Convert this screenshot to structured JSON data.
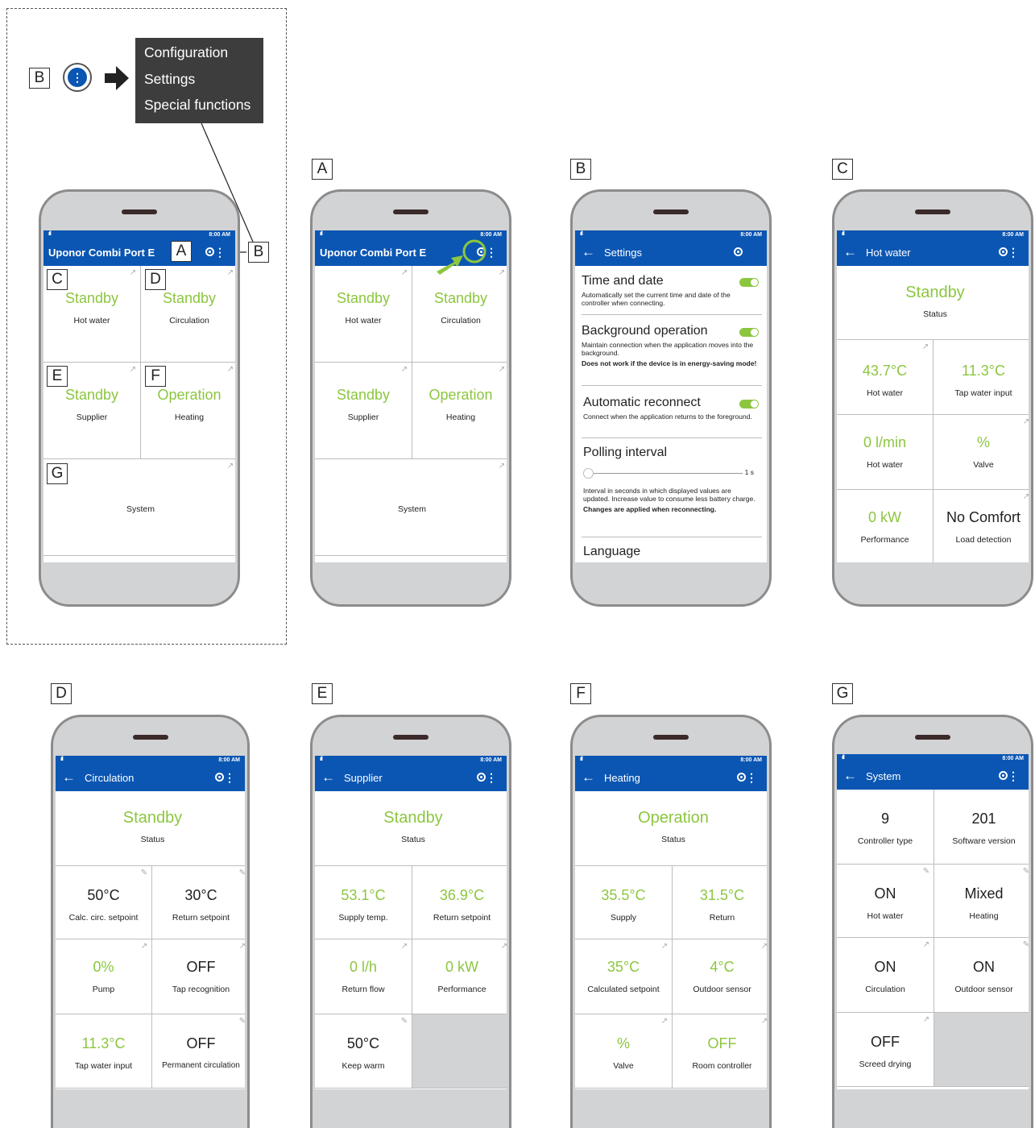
{
  "legend": {
    "letter": "B",
    "menu_items": [
      "Configuration",
      "Settings",
      "Special functions"
    ]
  },
  "labels": {
    "A": "A",
    "B": "B",
    "C": "C",
    "D": "D",
    "E": "E",
    "F": "F",
    "G": "G"
  },
  "status_time": "8:00 AM",
  "app_title": "Uponor Combi Port E",
  "overview": {
    "tiles": [
      {
        "value": "Standby",
        "label": "Hot water"
      },
      {
        "value": "Standby",
        "label": "Circulation"
      },
      {
        "value": "Standby",
        "label": "Supplier"
      },
      {
        "value": "Operation",
        "label": "Heating"
      },
      {
        "value": "",
        "label": "System"
      }
    ]
  },
  "settings": {
    "title": "Settings",
    "items": [
      {
        "heading": "Time and date",
        "desc": "Automatically set the current time and date of the controller when connecting."
      },
      {
        "heading": "Background operation",
        "desc": "Maintain connection when the application moves into the background.",
        "note": "Does not work if the device is in energy-saving mode!"
      },
      {
        "heading": "Automatic reconnect",
        "desc": "Connect when the application returns to the foreground."
      },
      {
        "heading": "Polling interval",
        "slider_value": "1 s",
        "desc": "Interval in seconds in which displayed values are updated. Increase value to consume less battery charge.",
        "note": "Changes are applied when reconnecting."
      },
      {
        "heading": "Language"
      }
    ]
  },
  "hot_water": {
    "title": "Hot water",
    "status": {
      "value": "Standby",
      "label": "Status"
    },
    "tiles": [
      {
        "value": "43.7°C",
        "label": "Hot water"
      },
      {
        "value": "11.3°C",
        "label": "Tap water input"
      },
      {
        "value": "0 l/min",
        "label": "Hot water"
      },
      {
        "value": "%",
        "label": "Valve"
      },
      {
        "value": "0 kW",
        "label": "Performance"
      },
      {
        "value": "No Comfort",
        "label": "Load detection"
      }
    ]
  },
  "circulation": {
    "title": "Circulation",
    "status": {
      "value": "Standby",
      "label": "Status"
    },
    "tiles": [
      {
        "value": "50°C",
        "label": "Calc. circ. setpoint"
      },
      {
        "value": "30°C",
        "label": "Return setpoint"
      },
      {
        "value": "0%",
        "label": "Pump"
      },
      {
        "value": "OFF",
        "label": "Tap recognition"
      },
      {
        "value": "11.3°C",
        "label": "Tap water input"
      },
      {
        "value": "OFF",
        "label": "Permanent circulation"
      }
    ]
  },
  "supplier": {
    "title": "Supplier",
    "status": {
      "value": "Standby",
      "label": "Status"
    },
    "tiles": [
      {
        "value": "53.1°C",
        "label": "Supply temp."
      },
      {
        "value": "36.9°C",
        "label": "Return setpoint"
      },
      {
        "value": "0 l/h",
        "label": "Return flow"
      },
      {
        "value": "0 kW",
        "label": "Performance"
      },
      {
        "value": "50°C",
        "label": "Keep warm"
      }
    ]
  },
  "heating": {
    "title": "Heating",
    "status": {
      "value": "Operation",
      "label": "Status"
    },
    "tiles": [
      {
        "value": "35.5°C",
        "label": "Supply"
      },
      {
        "value": "31.5°C",
        "label": "Return"
      },
      {
        "value": "35°C",
        "label": "Calculated setpoint"
      },
      {
        "value": "4°C",
        "label": "Outdoor sensor"
      },
      {
        "value": "%",
        "label": "Valve"
      },
      {
        "value": "OFF",
        "label": "Room controller"
      }
    ]
  },
  "system": {
    "title": "System",
    "tiles": [
      {
        "value": "9",
        "label": "Controller type"
      },
      {
        "value": "201",
        "label": "Software version"
      },
      {
        "value": "ON",
        "label": "Hot water"
      },
      {
        "value": "Mixed",
        "label": "Heating"
      },
      {
        "value": "ON",
        "label": "Circulation"
      },
      {
        "value": "ON",
        "label": "Outdoor sensor"
      },
      {
        "value": "OFF",
        "label": "Screed drying"
      }
    ]
  }
}
